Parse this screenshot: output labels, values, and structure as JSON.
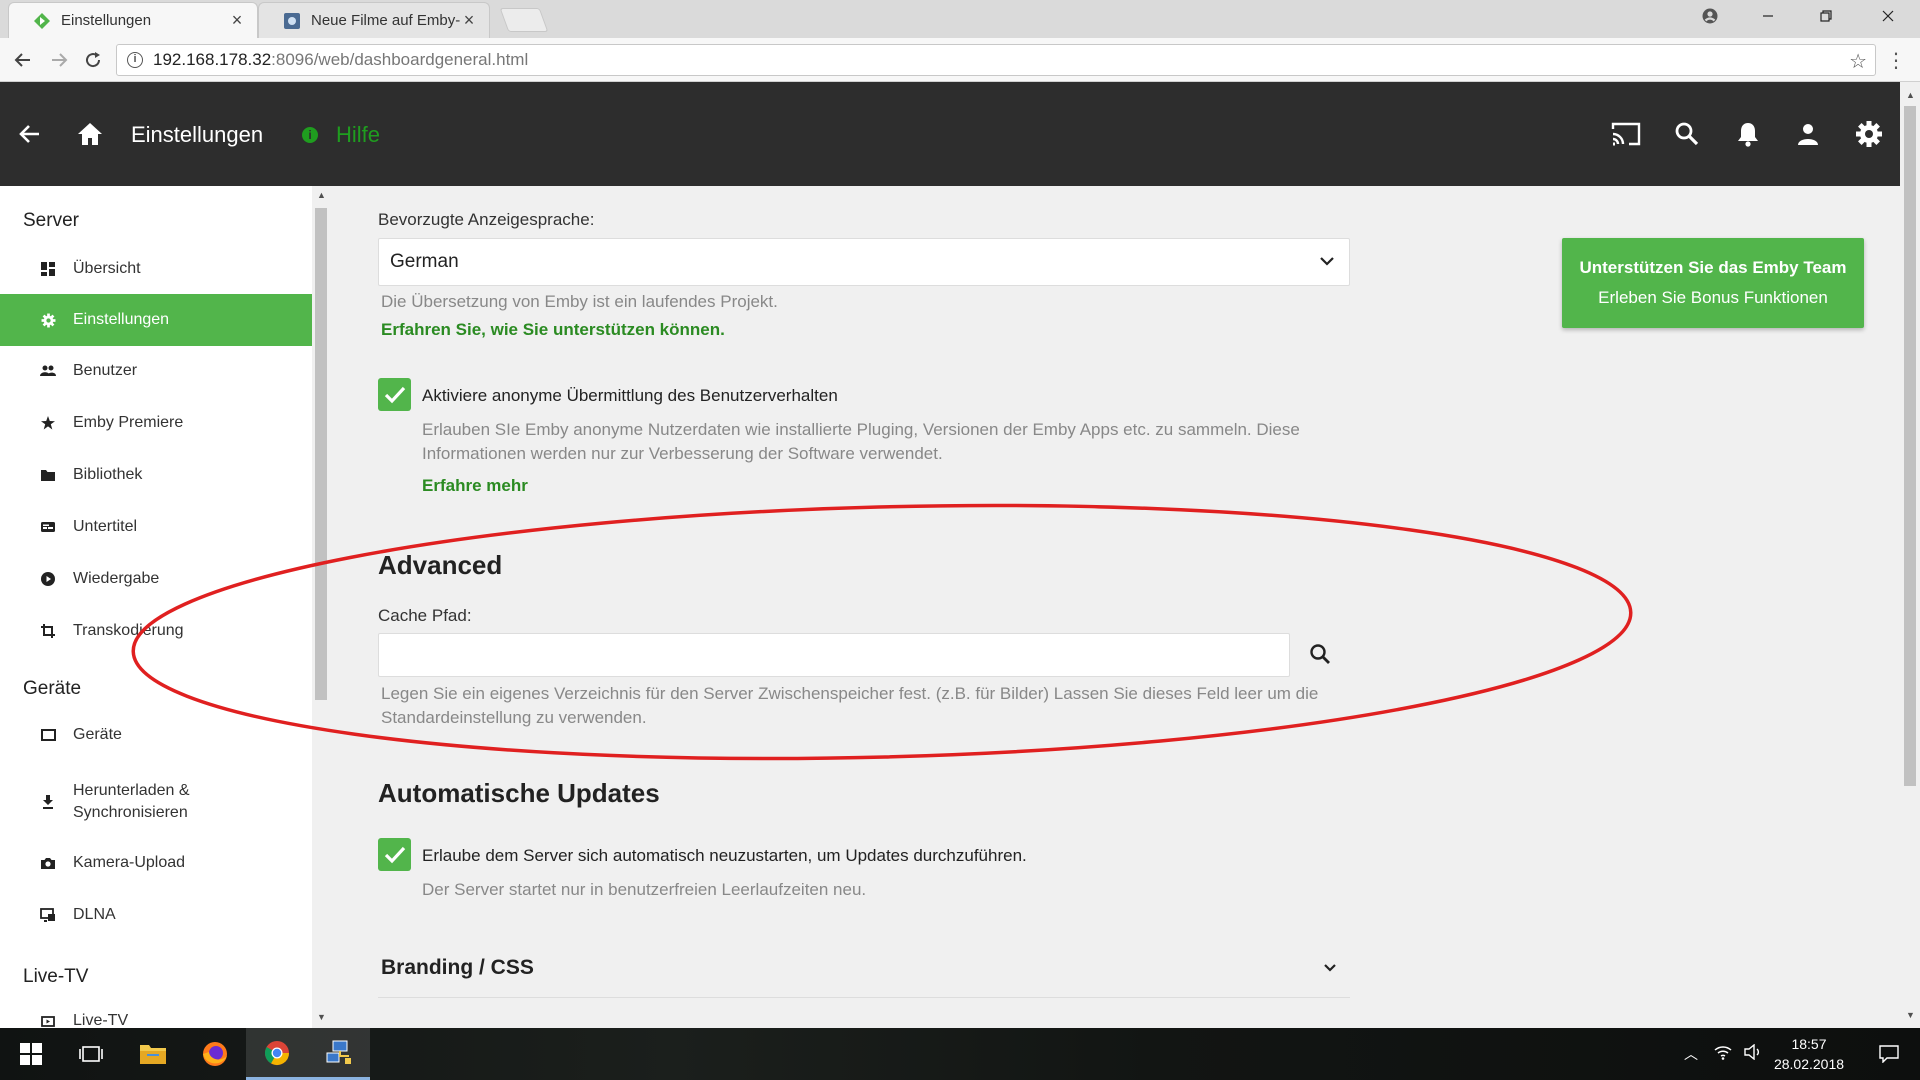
{
  "browser": {
    "tabs": [
      {
        "title": "Einstellungen",
        "active": true
      },
      {
        "title": "Neue Filme auf Emby-Se",
        "active": false
      }
    ],
    "url_host": "192.168.178.32",
    "url_path": ":8096/web/dashboardgeneral.html"
  },
  "header": {
    "title": "Einstellungen",
    "help_label": "Hilfe"
  },
  "sidebar": {
    "sections": [
      {
        "title": "Server"
      },
      {
        "title": "Geräte"
      },
      {
        "title": "Live-TV"
      }
    ],
    "items": [
      {
        "label": "Übersicht",
        "icon": "dashboard-icon",
        "active": false
      },
      {
        "label": "Einstellungen",
        "icon": "gear-icon",
        "active": true
      },
      {
        "label": "Benutzer",
        "icon": "users-icon",
        "active": false
      },
      {
        "label": "Emby Premiere",
        "icon": "star-icon",
        "active": false
      },
      {
        "label": "Bibliothek",
        "icon": "folder-icon",
        "active": false
      },
      {
        "label": "Untertitel",
        "icon": "subtitles-icon",
        "active": false
      },
      {
        "label": "Wiedergabe",
        "icon": "play-circle-icon",
        "active": false
      },
      {
        "label": "Transkodierung",
        "icon": "transcode-icon",
        "active": false
      },
      {
        "label": "Geräte",
        "icon": "tablet-icon",
        "active": false
      },
      {
        "label": "Herunterladen & Synchronisieren",
        "icon": "download-icon",
        "active": false
      },
      {
        "label": "Kamera-Upload",
        "icon": "camera-icon",
        "active": false
      },
      {
        "label": "DLNA",
        "icon": "dlna-icon",
        "active": false
      },
      {
        "label": "Live-TV",
        "icon": "tv-icon",
        "active": false
      }
    ]
  },
  "main": {
    "language": {
      "label": "Bevorzugte Anzeigesprache:",
      "value": "German",
      "help": "Die Übersetzung von Emby ist ein laufendes Projekt.",
      "link": "Erfahren Sie, wie Sie unterstützen können."
    },
    "anonymous": {
      "checked": true,
      "label": "Aktiviere anonyme Übermittlung des Benutzerverhalten",
      "help_line1": "Erlauben SIe Emby anonyme Nutzerdaten wie installierte Pluging, Versionen der Emby Apps etc. zu sammeln. Diese",
      "help_line2": "Informationen werden nur zur Verbesserung der Software verwendet.",
      "link": "Erfahre mehr"
    },
    "advanced": {
      "heading": "Advanced",
      "cache_label": "Cache Pfad:",
      "cache_value": "",
      "help_line1": "Legen Sie ein eigenes Verzeichnis für den Server Zwischenspeicher fest. (z.B. für Bilder) Lassen Sie dieses Feld leer um die",
      "help_line2": "Standardeinstellung zu verwenden."
    },
    "updates": {
      "heading": "Automatische Updates",
      "checked": true,
      "label": "Erlaube dem Server sich automatisch neuzustarten, um Updates durchzuführen.",
      "help": "Der Server startet nur in benutzerfreien Leerlaufzeiten neu."
    },
    "branding": {
      "title": "Branding / CSS"
    },
    "promo": {
      "line1": "Unterstützen Sie das Emby Team",
      "line2": "Erleben Sie Bonus Funktionen"
    }
  },
  "taskbar": {
    "time": "18:57",
    "date": "28.02.2018"
  },
  "colors": {
    "accent": "#52b54b",
    "link": "#2b8b22",
    "header": "#2d2d2d",
    "annotation": "#e02020"
  }
}
